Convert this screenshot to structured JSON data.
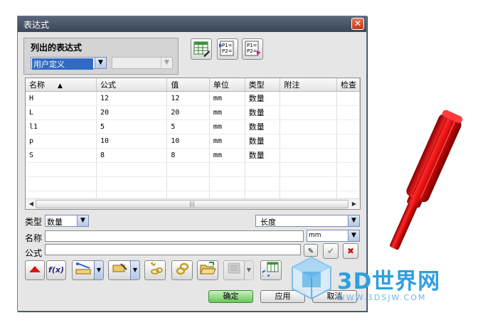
{
  "dialog": {
    "title": "表达式",
    "close_glyph": "✕"
  },
  "list_group": {
    "label": "列出的表达式",
    "filter_value": "用户定义",
    "filter2_value": ""
  },
  "toolbar_top": [
    {
      "icon": "spreadsheet-edit-icon",
      "label": ""
    },
    {
      "icon": "import-expressions-icon",
      "label": "P1=\nP2="
    },
    {
      "icon": "export-expressions-icon",
      "label": "P1=\nP2="
    }
  ],
  "table": {
    "columns": [
      "名称",
      "公式",
      "值",
      "单位",
      "类型",
      "附注",
      "检查"
    ],
    "sort_glyph": "▲",
    "rows": [
      [
        "H",
        "12",
        "12",
        "mm",
        "数量",
        "",
        ""
      ],
      [
        "L",
        "20",
        "20",
        "mm",
        "数量",
        "",
        ""
      ],
      [
        "l1",
        "5",
        "5",
        "mm",
        "数量",
        "",
        ""
      ],
      [
        "p",
        "10",
        "10",
        "mm",
        "数量",
        "",
        ""
      ],
      [
        "S",
        "8",
        "8",
        "mm",
        "数量",
        "",
        ""
      ]
    ],
    "empty_rows": 3,
    "scroll_thumb_glyph": "|||"
  },
  "type_row": {
    "label": "类型",
    "type_value": "数量",
    "dimension_value": "长度"
  },
  "name_row": {
    "label": "名称",
    "value": "",
    "unit_value": "mm"
  },
  "formula_row": {
    "label": "公式",
    "value": ""
  },
  "toolbar_bottom": {
    "function_label": "f(x)"
  },
  "buttons": {
    "ok": "确定",
    "apply": "应用",
    "cancel": "取消"
  },
  "watermark": {
    "text": "3D世界网",
    "url": "WWW.3DSJW.COM"
  },
  "colors": {
    "title_bar": "#4a5568",
    "selection": "#316ac5",
    "ok_button": "#6cc45c",
    "model_red": "#e0161a",
    "watermark_blue": "#2e9fe0"
  }
}
